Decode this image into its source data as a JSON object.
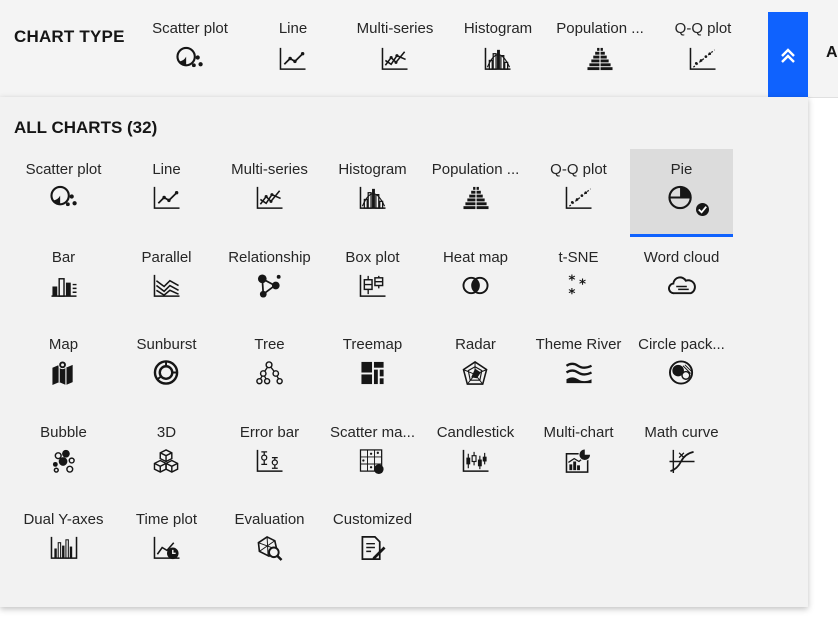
{
  "topbar": {
    "title": "CHART TYPE",
    "items": [
      {
        "label": "Scatter plot",
        "icon": "scatter-icon"
      },
      {
        "label": "Line",
        "icon": "line-icon"
      },
      {
        "label": "Multi-series",
        "icon": "multi-series-icon"
      },
      {
        "label": "Histogram",
        "icon": "histogram-icon"
      },
      {
        "label": "Population ...",
        "icon": "population-icon"
      },
      {
        "label": "Q-Q plot",
        "icon": "qq-plot-icon"
      }
    ],
    "collapse_icon": "chevron-double-up-icon",
    "cut_label": "A"
  },
  "panel": {
    "title": "ALL CHARTS (32)",
    "selected": "Pie",
    "charts": [
      {
        "label": "Scatter plot",
        "icon": "scatter-icon"
      },
      {
        "label": "Line",
        "icon": "line-icon"
      },
      {
        "label": "Multi-series",
        "icon": "multi-series-icon"
      },
      {
        "label": "Histogram",
        "icon": "histogram-icon"
      },
      {
        "label": "Population ...",
        "icon": "population-icon"
      },
      {
        "label": "Q-Q plot",
        "icon": "qq-plot-icon"
      },
      {
        "label": "Pie",
        "icon": "pie-icon"
      },
      {
        "label": "Bar",
        "icon": "bar-icon"
      },
      {
        "label": "Parallel",
        "icon": "parallel-icon"
      },
      {
        "label": "Relationship",
        "icon": "relationship-icon"
      },
      {
        "label": "Box plot",
        "icon": "box-plot-icon"
      },
      {
        "label": "Heat map",
        "icon": "heat-map-icon"
      },
      {
        "label": "t-SNE",
        "icon": "tsne-icon"
      },
      {
        "label": "Word cloud",
        "icon": "word-cloud-icon"
      },
      {
        "label": "Map",
        "icon": "map-icon"
      },
      {
        "label": "Sunburst",
        "icon": "sunburst-icon"
      },
      {
        "label": "Tree",
        "icon": "tree-icon"
      },
      {
        "label": "Treemap",
        "icon": "treemap-icon"
      },
      {
        "label": "Radar",
        "icon": "radar-icon"
      },
      {
        "label": "Theme River",
        "icon": "theme-river-icon"
      },
      {
        "label": "Circle pack...",
        "icon": "circle-pack-icon"
      },
      {
        "label": "Bubble",
        "icon": "bubble-icon"
      },
      {
        "label": "3D",
        "icon": "3d-icon"
      },
      {
        "label": "Error bar",
        "icon": "error-bar-icon"
      },
      {
        "label": "Scatter ma...",
        "icon": "scatter-matrix-icon"
      },
      {
        "label": "Candlestick",
        "icon": "candlestick-icon"
      },
      {
        "label": "Multi-chart",
        "icon": "multi-chart-icon"
      },
      {
        "label": "Math curve",
        "icon": "math-curve-icon"
      },
      {
        "label": "Dual Y-axes",
        "icon": "dual-y-axes-icon"
      },
      {
        "label": "Time plot",
        "icon": "time-plot-icon"
      },
      {
        "label": "Evaluation",
        "icon": "evaluation-icon"
      },
      {
        "label": "Customized",
        "icon": "customized-icon"
      }
    ]
  },
  "colors": {
    "accent": "#0f62fe",
    "panel": "#f2f2f2",
    "selected_bg": "#dcdcdc",
    "icon": "#161616"
  }
}
